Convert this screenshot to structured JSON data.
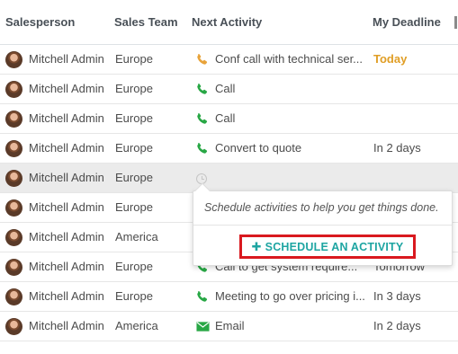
{
  "columns": {
    "salesperson": "Salesperson",
    "sales_team": "Sales Team",
    "next_activity": "Next Activity",
    "my_deadline": "My Deadline"
  },
  "rows": [
    {
      "salesperson": "Mitchell Admin",
      "team": "Europe",
      "activity_icon": "phone-icon",
      "activity_color": "#e8a33a",
      "activity": "Conf call with technical ser...",
      "deadline": "Today"
    },
    {
      "salesperson": "Mitchell Admin",
      "team": "Europe",
      "activity_icon": "phone-icon",
      "activity_color": "#28a745",
      "activity": "Call",
      "deadline": ""
    },
    {
      "salesperson": "Mitchell Admin",
      "team": "Europe",
      "activity_icon": "phone-icon",
      "activity_color": "#28a745",
      "activity": "Call",
      "deadline": ""
    },
    {
      "salesperson": "Mitchell Admin",
      "team": "Europe",
      "activity_icon": "phone-icon",
      "activity_color": "#28a745",
      "activity": "Convert to quote",
      "deadline": "In 2 days"
    },
    {
      "salesperson": "Mitchell Admin",
      "team": "Europe",
      "activity_icon": "clock-icon",
      "activity_color": "#c5c5c5",
      "activity": "",
      "deadline": ""
    },
    {
      "salesperson": "Mitchell Admin",
      "team": "Europe",
      "activity_icon": "",
      "activity": "",
      "deadline": ""
    },
    {
      "salesperson": "Mitchell Admin",
      "team": "America",
      "activity_icon": "",
      "activity": "",
      "deadline": ""
    },
    {
      "salesperson": "Mitchell Admin",
      "team": "Europe",
      "activity_icon": "phone-icon",
      "activity_color": "#28a745",
      "activity": "Call to get system require...",
      "deadline": "Tomorrow"
    },
    {
      "salesperson": "Mitchell Admin",
      "team": "Europe",
      "activity_icon": "phone-icon",
      "activity_color": "#28a745",
      "activity": "Meeting to go over pricing i...",
      "deadline": "In 3 days"
    },
    {
      "salesperson": "Mitchell Admin",
      "team": "America",
      "activity_icon": "envelope-icon",
      "activity_color": "#28a745",
      "activity": "Email",
      "deadline": "In 2 days"
    }
  ],
  "popover": {
    "message": "Schedule activities to help you get things done.",
    "button_label": "SCHEDULE AN ACTIVITY",
    "button_icon": "plus-icon"
  },
  "colors": {
    "today": "#e09e25",
    "phone_green": "#28a745",
    "accent_teal": "#1ea5a2",
    "highlight_red": "#d9191f"
  }
}
